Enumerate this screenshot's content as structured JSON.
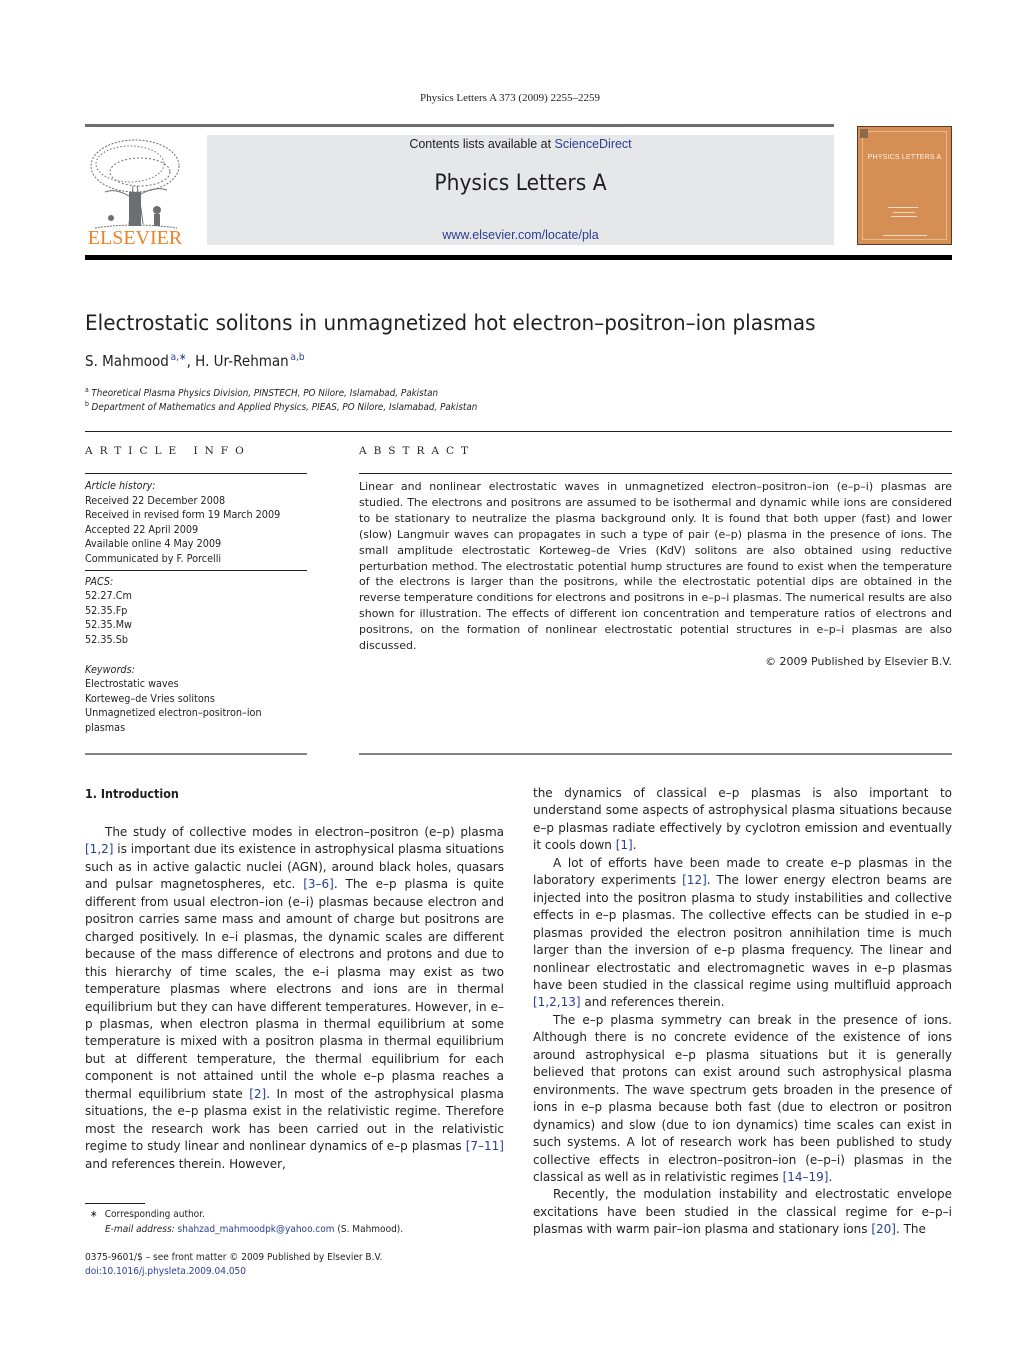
{
  "running_head": "Physics Letters A 373 (2009) 2255–2259",
  "masthead": {
    "publisher_logo": "ELSEVIER",
    "contents_prefix": "Contents lists available at ",
    "contents_link": "ScienceDirect",
    "journal_name": "Physics Letters A",
    "journal_url": "www.elsevier.com/locate/pla",
    "cover_title": "PHYSICS LETTERS A"
  },
  "article": {
    "title": "Electrostatic solitons in unmagnetized hot electron–positron–ion plasmas",
    "authors": [
      {
        "name": "S. Mahmood",
        "marks": "a,∗",
        "separator": ", "
      },
      {
        "name": "H. Ur-Rehman",
        "marks": "a,b",
        "separator": ""
      }
    ],
    "affiliations": [
      {
        "mark": "a",
        "text": "Theoretical Plasma Physics Division, PINSTECH, PO Nilore, Islamabad, Pakistan"
      },
      {
        "mark": "b",
        "text": "Department of Mathematics and Applied Physics, PIEAS, PO Nilore, Islamabad, Pakistan"
      }
    ]
  },
  "article_info": {
    "heading": "ARTICLE INFO",
    "history_label": "Article history:",
    "history": [
      "Received 22 December 2008",
      "Received in revised form 19 March 2009",
      "Accepted 22 April 2009",
      "Available online 4 May 2009",
      "Communicated by F. Porcelli"
    ],
    "pacs_label": "PACS:",
    "pacs": [
      "52.27.Cm",
      "52.35.Fp",
      "52.35.Mw",
      "52.35.Sb"
    ],
    "keywords_label": "Keywords:",
    "keywords": [
      "Electrostatic waves",
      "Korteweg–de Vries solitons",
      "Unmagnetized electron–positron–ion",
      "plasmas"
    ]
  },
  "abstract": {
    "heading": "ABSTRACT",
    "text": "Linear and nonlinear electrostatic waves in unmagnetized electron–positron–ion (e–p–i) plasmas are studied. The electrons and positrons are assumed to be isothermal and dynamic while ions are considered to be stationary to neutralize the plasma background only. It is found that both upper (fast) and lower (slow) Langmuir waves can propagates in such a type of pair (e–p) plasma in the presence of ions. The small amplitude electrostatic Korteweg–de Vries (KdV) solitons are also obtained using reductive perturbation method. The electrostatic potential hump structures are found to exist when the temperature of the electrons is larger than the positrons, while the electrostatic potential dips are obtained in the reverse temperature conditions for electrons and positrons in e–p–i plasmas. The numerical results are also shown for illustration. The effects of different ion concentration and temperature ratios of electrons and positrons, on the formation of nonlinear electrostatic potential structures in e–p–i plasmas are also discussed.",
    "copyright": "© 2009 Published by Elsevier B.V."
  },
  "introduction": {
    "heading": "1. Introduction",
    "left_col": [
      {
        "parts": [
          {
            "t": "The study of collective modes in electron–positron (e–p) plasma "
          },
          {
            "c": "[1,2]"
          },
          {
            "t": " is important due its existence in astrophysical plasma situations such as in active galactic nuclei (AGN), around black holes, quasars and pulsar magnetospheres, etc. "
          },
          {
            "c": "[3–6]"
          },
          {
            "t": ". The e–p plasma is quite different from usual electron–ion (e–i) plasmas because electron and positron carries same mass and amount of charge but positrons are charged positively. In e–i plasmas, the dynamic scales are different because of the mass difference of electrons and protons and due to this hierarchy of time scales, the e–i plasma may exist as two temperature plasmas where electrons and ions are in thermal equilibrium but they can have different temperatures. However, in e–p plasmas, when electron plasma in thermal equilibrium at some temperature is mixed with a positron plasma in thermal equilibrium but at different temperature, the thermal equilibrium for each component is not attained until the whole e–p plasma reaches a thermal equilibrium state "
          },
          {
            "c": "[2]"
          },
          {
            "t": ". In most of the astrophysical plasma situations, the e–p plasma exist in the relativistic regime. Therefore most the research work has been carried out in the relativistic regime to study linear and nonlinear dynamics of e–p plasmas "
          },
          {
            "c": "[7–11]"
          },
          {
            "t": " and references therein. However,"
          }
        ]
      }
    ],
    "right_col": [
      {
        "cont": true,
        "parts": [
          {
            "t": "the dynamics of classical e–p plasmas is also important to understand some aspects of astrophysical plasma situations because e–p plasmas radiate effectively by cyclotron emission and eventually it cools down "
          },
          {
            "c": "[1]"
          },
          {
            "t": "."
          }
        ]
      },
      {
        "parts": [
          {
            "t": "A lot of efforts have been made to create e–p plasmas in the laboratory experiments "
          },
          {
            "c": "[12]"
          },
          {
            "t": ". The lower energy electron beams are injected into the positron plasma to study instabilities and collective effects in e–p plasmas. The collective effects can be studied in e–p plasmas provided the electron positron annihilation time is much larger than the inversion of e–p plasma frequency. The linear and nonlinear electrostatic and electromagnetic waves in e–p plasmas have been studied in the classical regime using multifluid approach "
          },
          {
            "c": "[1,2,13]"
          },
          {
            "t": " and references therein."
          }
        ]
      },
      {
        "parts": [
          {
            "t": "The e–p plasma symmetry can break in the presence of ions. Although there is no concrete evidence of the existence of ions around astrophysical e–p plasma situations but it is generally believed that protons can exist around such astrophysical plasma environments. The wave spectrum gets broaden in the presence of ions in e–p plasma because both fast (due to electron or positron dynamics) and slow (due to ion dynamics) time scales can exist in such systems. A lot of research work has been published to study collective effects in electron–positron–ion (e–p–i) plasmas in the classical as well as in relativistic regimes "
          },
          {
            "c": "[14–19]"
          },
          {
            "t": "."
          }
        ]
      },
      {
        "parts": [
          {
            "t": "Recently, the modulation instability and electrostatic envelope excitations have been studied in the classical regime for e–p–i plasmas with warm pair–ion plasma and stationary ions "
          },
          {
            "c": "[20]"
          },
          {
            "t": ". The"
          }
        ]
      }
    ]
  },
  "footnotes": {
    "star": "∗",
    "corresponding": "Corresponding author.",
    "email_label": "E-mail address:",
    "email": "shahzad_mahmoodpk@yahoo.com",
    "email_owner": " (S. Mahmood).",
    "front_matter": "0375-9601/$ – see front matter  © 2009 Published by Elsevier B.V.",
    "doi": "doi:10.1016/j.physleta.2009.04.050"
  },
  "colors": {
    "link": "#2a3e95",
    "elsevier_orange": "#f08124",
    "banner_bg": "#e6e7e8",
    "cover": "#d58f55"
  }
}
